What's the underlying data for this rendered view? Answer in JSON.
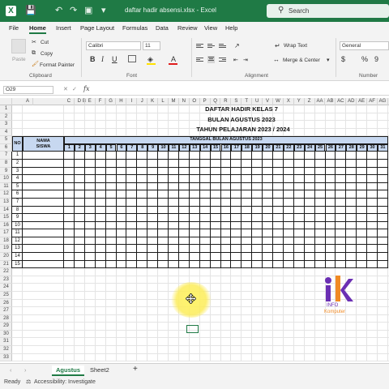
{
  "titlebar": {
    "autosave_icon": "save-icon",
    "undo_icon": "undo-icon",
    "redo_icon": "redo-icon",
    "title": "daftar hadir absensi.xlsx  -  Excel",
    "search_placeholder": "Search"
  },
  "menu": [
    "File",
    "Home",
    "Insert",
    "Page Layout",
    "Formulas",
    "Data",
    "Review",
    "View",
    "Help"
  ],
  "ribbon": {
    "paste": "Paste",
    "cut": "Cut",
    "copy": "Copy",
    "format_painter": "Format Painter",
    "clipboard": "Clipboard",
    "font_name": "Calibri",
    "font_size": "11",
    "font": "Font",
    "wrap_text": "Wrap Text",
    "merge_center": "Merge & Center",
    "alignment": "Alignment",
    "number_format": "General",
    "number": "Number",
    "bold": "B",
    "italic": "I",
    "underline": "U",
    "font_color": "A",
    "currency": "$",
    "percent": "%",
    "comma": "9"
  },
  "formula_bar": {
    "name_box": "O29",
    "fx_label": "fx",
    "value": ""
  },
  "sheet": {
    "columns": [
      "A",
      "B",
      "C",
      "D",
      "E",
      "F",
      "G",
      "H",
      "I",
      "J",
      "K",
      "L",
      "M",
      "N",
      "O",
      "P",
      "Q",
      "R",
      "S",
      "T",
      "U",
      "V",
      "W",
      "X",
      "Y",
      "Z",
      "AA",
      "AB",
      "AC",
      "AD",
      "AE",
      "AF",
      "AG"
    ],
    "rows": [
      "1",
      "2",
      "3",
      "4",
      "5",
      "6",
      "7",
      "8",
      "9",
      "10",
      "11",
      "12",
      "13",
      "14",
      "15",
      "16",
      "17",
      "18",
      "19",
      "20",
      "21",
      "22",
      "23",
      "24",
      "25",
      "26",
      "27",
      "28",
      "29",
      "30",
      "31",
      "32",
      "33"
    ],
    "title1": "DAFTAR HADIR KELAS 7",
    "title2": "BULAN AGUSTUS 2023",
    "title3": "TAHUN PELAJARAN 2023 / 2024",
    "col_no": "NO",
    "col_nama_1": "NAMA",
    "col_nama_2": "SISWA",
    "tanggal_header": "TANGGAL BULAN AGUSTUS 2023",
    "days": [
      "1",
      "2",
      "3",
      "4",
      "5",
      "6",
      "7",
      "8",
      "9",
      "10",
      "11",
      "12",
      "13",
      "14",
      "15",
      "16",
      "17",
      "18",
      "19",
      "20",
      "21",
      "22",
      "23",
      "24",
      "25",
      "26",
      "27",
      "28",
      "29",
      "30",
      "31"
    ],
    "row_numbers": [
      "1",
      "2",
      "3",
      "4",
      "5",
      "6",
      "7",
      "8",
      "9",
      "10",
      "11",
      "12",
      "13",
      "14",
      "15"
    ]
  },
  "watermark": {
    "line1": "INFO",
    "line2": "Komputer",
    "accent_purple": "#6b2fb3",
    "accent_orange": "#f08a24"
  },
  "tabs": {
    "active": "Agustus",
    "other": "Sheet2",
    "add": "+"
  },
  "status": {
    "ready": "Ready",
    "accessibility": "Accessibility: Investigate"
  },
  "colors": {
    "excel_green": "#1f7a45",
    "header_fill": "#c7d8f0"
  }
}
